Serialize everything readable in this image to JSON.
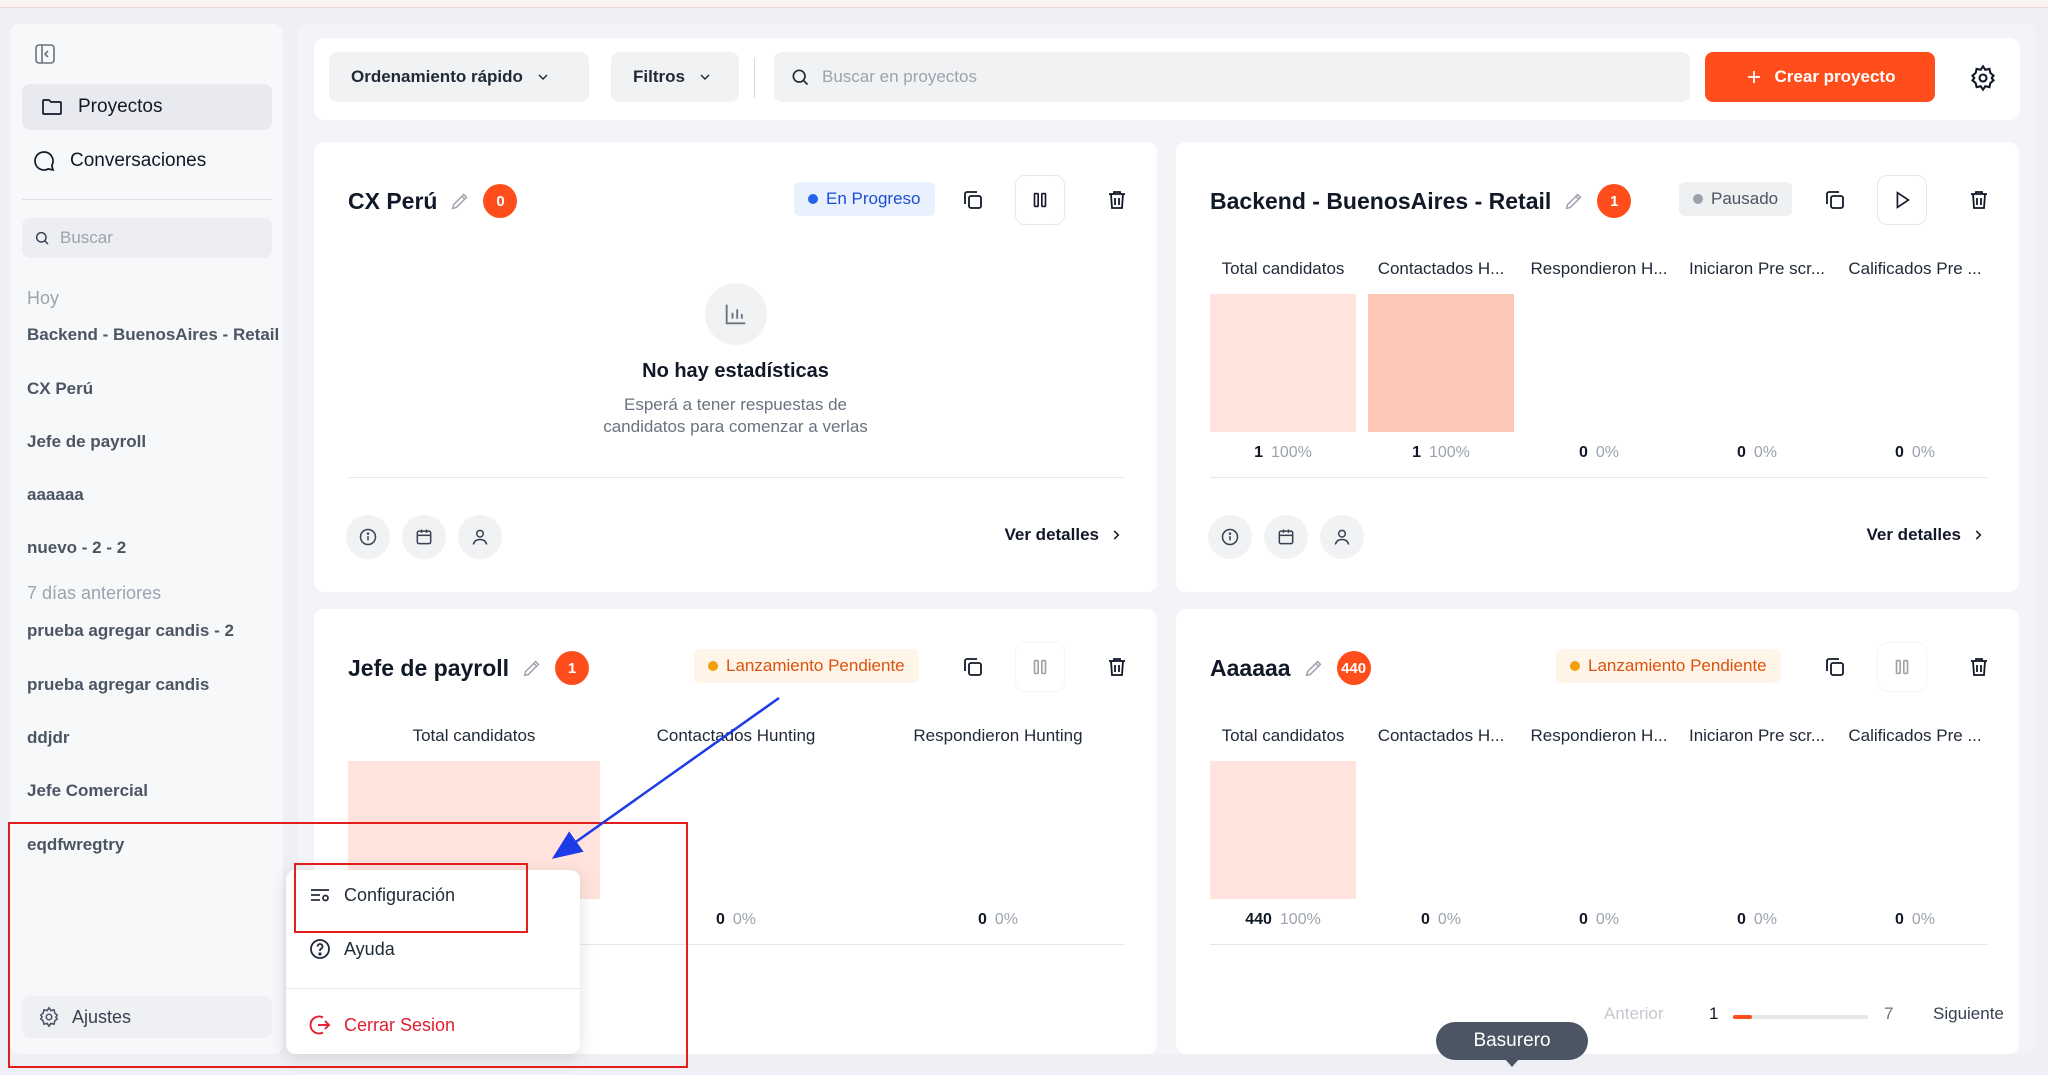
{
  "sidebar": {
    "nav": [
      {
        "label": "Proyectos",
        "icon": "folder-icon"
      },
      {
        "label": "Conversaciones",
        "icon": "chat-icon"
      }
    ],
    "search_placeholder": "Buscar",
    "groups": [
      {
        "label": "Hoy",
        "items": [
          "Backend - BuenosAires - Retail",
          "CX Perú",
          "Jefe de payroll",
          "aaaaaa",
          "nuevo - 2 - 2"
        ]
      },
      {
        "label": "7 días anteriores",
        "items": [
          "prueba agregar candis - 2",
          "prueba agregar candis",
          "ddjdr",
          "Jefe Comercial",
          "eqdfwregtry"
        ]
      }
    ],
    "settings_label": "Ajustes"
  },
  "toolbar": {
    "sort_label": "Ordenamiento rápido",
    "filter_label": "Filtros",
    "search_placeholder": "Buscar en proyectos",
    "create_label": "Crear proyecto"
  },
  "colors": {
    "accent": "#ff4d1c",
    "annotation": "#e11d1d",
    "arrow": "#1d3be6"
  },
  "cards": [
    {
      "title": "CX Perú",
      "count": "0",
      "status": "En Progreso",
      "empty_title": "No hay estadísticas",
      "empty_sub_1": "Esperá a tener respuestas de",
      "empty_sub_2": "candidatos para comenzar a verlas",
      "details_label": "Ver detalles"
    },
    {
      "title": "Backend - BuenosAires - Retail",
      "count": "1",
      "status": "Pausado",
      "details_label": "Ver detalles",
      "metrics": [
        {
          "label": "Total candidatos",
          "value": "1",
          "pct": "100%"
        },
        {
          "label": "Contactados H...",
          "value": "1",
          "pct": "100%"
        },
        {
          "label": "Respondieron H...",
          "value": "0",
          "pct": "0%"
        },
        {
          "label": "Iniciaron Pre scr...",
          "value": "0",
          "pct": "0%"
        },
        {
          "label": "Calificados Pre ...",
          "value": "0",
          "pct": "0%"
        }
      ]
    },
    {
      "title": "Jefe de payroll",
      "count": "1",
      "status": "Lanzamiento Pendiente",
      "metrics": [
        {
          "label": "Total candidatos",
          "value": "",
          "pct": ""
        },
        {
          "label": "Contactados Hunting",
          "value": "0",
          "pct": "0%"
        },
        {
          "label": "Respondieron Hunting",
          "value": "0",
          "pct": "0%"
        }
      ]
    },
    {
      "title": "Aaaaaa",
      "count": "440",
      "status": "Lanzamiento Pendiente",
      "metrics": [
        {
          "label": "Total candidatos",
          "value": "440",
          "pct": "100%"
        },
        {
          "label": "Contactados H...",
          "value": "0",
          "pct": "0%"
        },
        {
          "label": "Respondieron H...",
          "value": "0",
          "pct": "0%"
        },
        {
          "label": "Iniciaron Pre scr...",
          "value": "0",
          "pct": "0%"
        },
        {
          "label": "Calificados Pre ...",
          "value": "0",
          "pct": "0%"
        }
      ]
    }
  ],
  "pagination": {
    "prev_label": "Anterior",
    "current": "1",
    "total": "7",
    "next_label": "Siguiente",
    "progress": 0.14
  },
  "tooltip": "Basurero",
  "popup": {
    "config_label": "Configuración",
    "help_label": "Ayuda",
    "logout_label": "Cerrar Sesion"
  }
}
